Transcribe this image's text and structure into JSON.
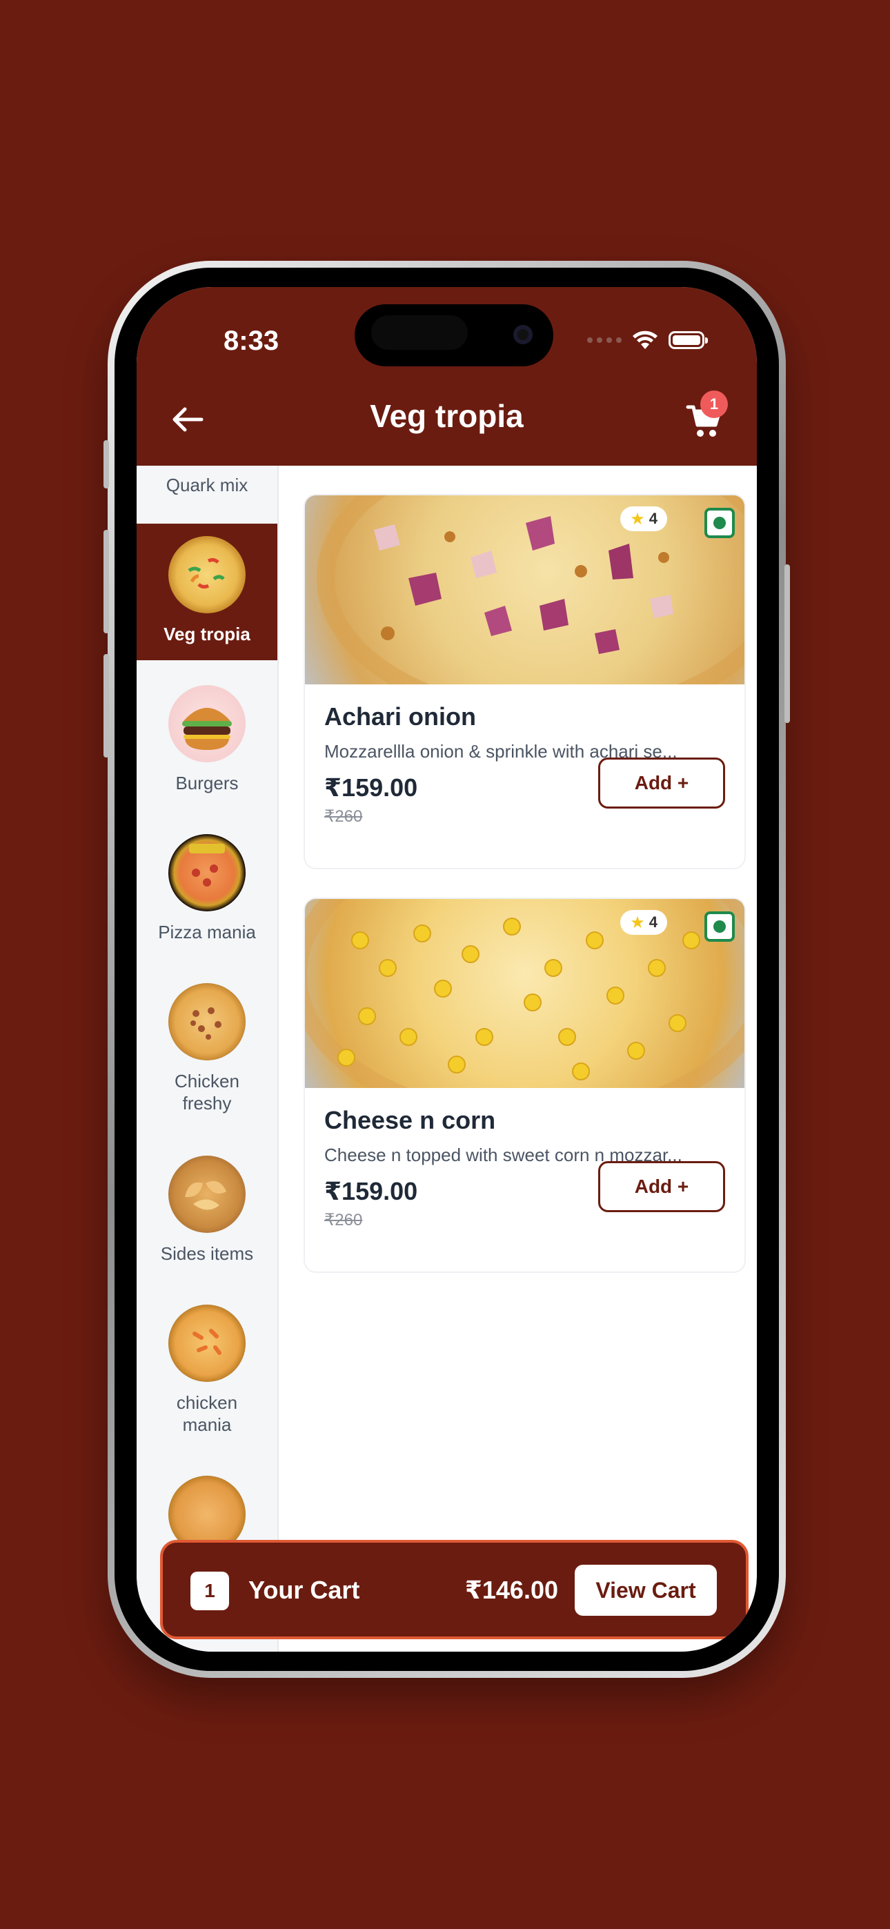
{
  "status_bar": {
    "time": "8:33"
  },
  "header": {
    "title": "Veg tropia",
    "cart_badge": "1"
  },
  "sidebar": {
    "items": [
      {
        "label": "Quark mix",
        "icon": "pizza-icon"
      },
      {
        "label": "Veg tropia",
        "icon": "pizza-icon",
        "active": true
      },
      {
        "label": "Burgers",
        "icon": "burger-icon"
      },
      {
        "label": "Pizza mania",
        "icon": "pizza-icon"
      },
      {
        "label": "Chicken freshy",
        "icon": "pizza-icon"
      },
      {
        "label": "Sides items",
        "icon": "garlic-bread-icon"
      },
      {
        "label": "chicken mania",
        "icon": "pizza-icon"
      }
    ]
  },
  "products": [
    {
      "title": "Achari onion",
      "description": "Mozzarellla onion & sprinkle with achari se...",
      "price": "₹159.00",
      "old_price": "₹260",
      "rating": "4",
      "add_label": "Add +"
    },
    {
      "title": "Cheese n corn",
      "description": "Cheese n topped with sweet corn n mozzar...",
      "price": "₹159.00",
      "old_price": "₹260",
      "rating": "4",
      "add_label": "Add +"
    }
  ],
  "cart_bar": {
    "count": "1",
    "label": "Your Cart",
    "total": "₹146.00",
    "button_label": "View Cart"
  },
  "colors": {
    "brand": "#6b1c10",
    "cart_border": "#e05a34",
    "badge": "#ef5b5b",
    "veg": "#1e8a4c"
  }
}
